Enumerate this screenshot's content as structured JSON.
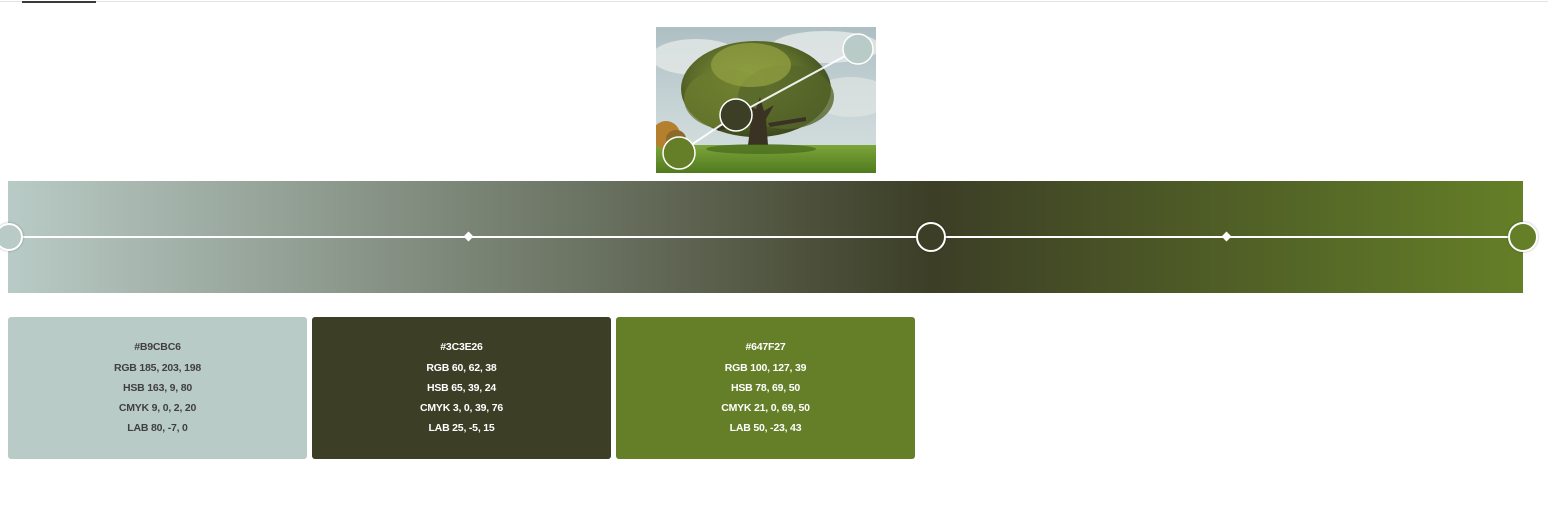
{
  "photo": {
    "description_icon": "tree-photo"
  },
  "gradient": {
    "stops": [
      {
        "hex": "#B9CBC6"
      },
      {
        "hex": "#3C3E26"
      },
      {
        "hex": "#647F27"
      }
    ]
  },
  "swatches": [
    {
      "hex": "#B9CBC6",
      "rgb": "RGB 185, 203, 198",
      "hsb": "HSB 163, 9, 80",
      "cmyk": "CMYK 9, 0, 2, 20",
      "lab": "LAB 80, -7, 0",
      "text_color": "#404040"
    },
    {
      "hex": "#3C3E26",
      "rgb": "RGB 60, 62, 38",
      "hsb": "HSB 65, 39, 24",
      "cmyk": "CMYK 3, 0, 39, 76",
      "lab": "LAB 25, -5, 15",
      "text_color": "#ffffff"
    },
    {
      "hex": "#647F27",
      "rgb": "RGB 100, 127, 39",
      "hsb": "HSB 78, 69, 50",
      "cmyk": "CMYK 21, 0, 69, 50",
      "lab": "LAB 50, -23, 43",
      "text_color": "#ffffff"
    }
  ]
}
